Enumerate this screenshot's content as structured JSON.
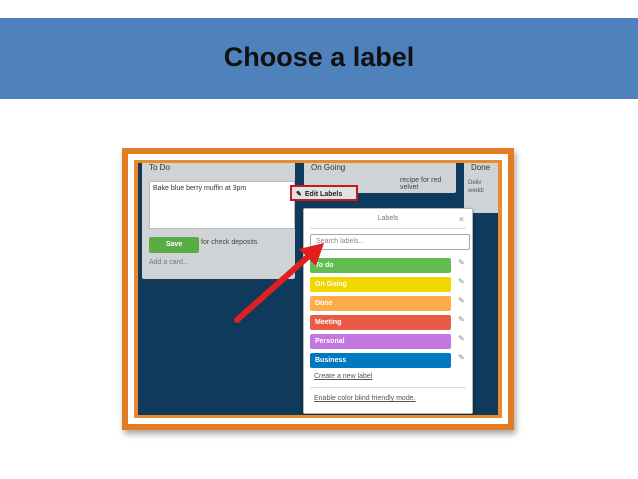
{
  "slide": {
    "title": "Choose a label"
  },
  "board": {
    "lists": [
      {
        "title": "To Do"
      },
      {
        "title": "On Going"
      },
      {
        "title": "Done"
      }
    ],
    "composer_text": "Bake blue berry muffin at 3pm",
    "save_label": "Save",
    "todo_peek": "for check deposits",
    "add_card_label": "Add a card...",
    "ongoing_peek": "recipe for red velvet",
    "done_peek": "Deliv\nweddi"
  },
  "edit_labels_button": {
    "label": "Edit Labels",
    "icon": "pencil-icon"
  },
  "labels_popover": {
    "title": "Labels",
    "close_icon": "×",
    "search_placeholder": "Search labels...",
    "labels": [
      {
        "name": "To do",
        "color": "#61bd4f"
      },
      {
        "name": "On Going",
        "color": "#f2d600"
      },
      {
        "name": "Done",
        "color": "#ffab4a"
      },
      {
        "name": "Meeting",
        "color": "#eb5a46"
      },
      {
        "name": "Personal",
        "color": "#c377e0"
      },
      {
        "name": "Business",
        "color": "#0079bf"
      }
    ],
    "create_label": "Create a new label",
    "colorblind_label": "Enable color blind friendly mode."
  },
  "accent": {
    "banner": "#4f81bd",
    "frame": "#e37b25",
    "arrow": "#e02020",
    "highlight": "#c01c1c"
  }
}
